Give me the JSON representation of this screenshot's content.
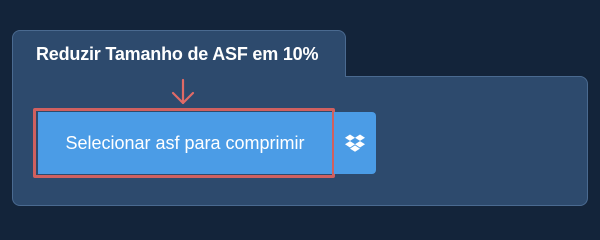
{
  "tab": {
    "title": "Reduzir Tamanho de ASF em 10%"
  },
  "upload": {
    "select_label": "Selecionar asf para comprimir",
    "dropbox_icon": "dropbox-icon",
    "arrow_icon": "arrow-down-icon"
  },
  "colors": {
    "background": "#13243a",
    "panel": "#2d4a6d",
    "button": "#4b9ce6",
    "highlight": "#d0605f"
  }
}
